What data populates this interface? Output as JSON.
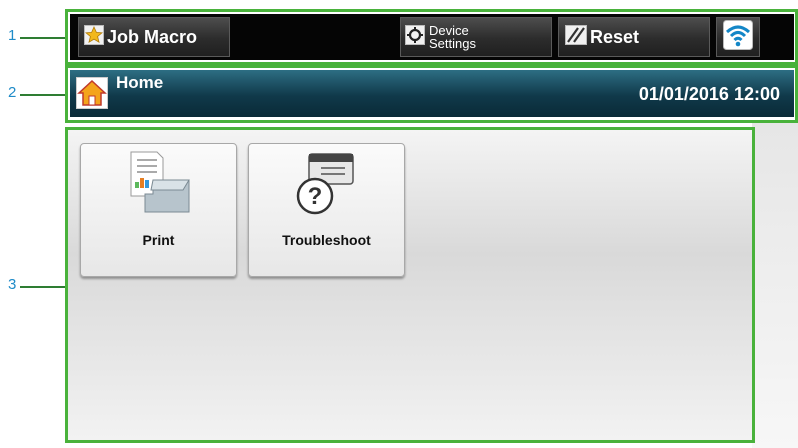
{
  "callouts": [
    "1",
    "2",
    "3"
  ],
  "topbar": {
    "job_macro": "Job Macro",
    "device_settings_line1": "Device",
    "device_settings_line2": "Settings",
    "reset": "Reset",
    "wifi_icon": "wifi-icon"
  },
  "header": {
    "title": "Home",
    "datetime": "01/01/2016 12:00",
    "home_icon": "home-icon"
  },
  "tiles": [
    {
      "label": "Print",
      "icon": "print-icon"
    },
    {
      "label": "Troubleshoot",
      "icon": "troubleshoot-icon"
    }
  ],
  "colors": {
    "callout_number": "#1f8bc8",
    "frame": "#49b23b",
    "header_bg": "#10394a",
    "topbar_bg": "#050505"
  }
}
